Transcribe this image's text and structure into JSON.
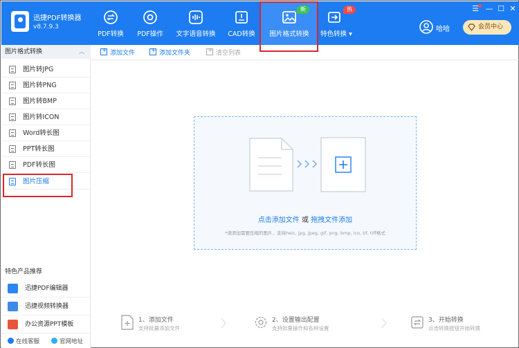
{
  "app": {
    "name": "迅捷PDF转换器",
    "version": "v8.7.9.3"
  },
  "nav": [
    {
      "label": "PDF转换",
      "icon": "swap-circle-icon"
    },
    {
      "label": "PDF操作",
      "icon": "gear-circle-icon"
    },
    {
      "label": "文字语音转换",
      "icon": "soundwave-icon"
    },
    {
      "label": "CAD转换",
      "icon": "cad-icon"
    },
    {
      "label": "图片格式转换",
      "icon": "image-icon",
      "badge": "新"
    },
    {
      "label": "特色转换",
      "icon": "feature-icon",
      "badge": "热"
    }
  ],
  "user": {
    "name": "哈哈",
    "member_label": "会员中心"
  },
  "sidebar": {
    "header": "图片格式转换",
    "items": [
      {
        "label": "图片转JPG"
      },
      {
        "label": "图片转PNG"
      },
      {
        "label": "图片转BMP"
      },
      {
        "label": "图片转ICON"
      },
      {
        "label": "Word转长图"
      },
      {
        "label": "PPT转长图"
      },
      {
        "label": "PDF转长图"
      },
      {
        "label": "图片压缩"
      }
    ],
    "recommend_title": "特色产品推荐",
    "recommend": [
      {
        "label": "迅捷PDF编辑器"
      },
      {
        "label": "迅捷视频转换器"
      },
      {
        "label": "办公资源PPT模板"
      }
    ],
    "links": [
      {
        "label": "在线客服"
      },
      {
        "label": "官网地址"
      }
    ]
  },
  "toolbar": {
    "add_file": "添加文件",
    "add_folder": "添加文件夹",
    "clear_list": "清空列表"
  },
  "dropzone": {
    "click_add": "点击添加文件",
    "or": "或",
    "drag_add": "拖拽文件添加",
    "hint": "*请添加需要压缩的图片，支持heic, jpg, jpeg, gif, png, bmp, ico, tif, tiff格式"
  },
  "steps": [
    {
      "title": "1、添加文件",
      "desc": "支持批量添加文件"
    },
    {
      "title": "2、设置输出配置",
      "desc": "支持批量操作和各种设置"
    },
    {
      "title": "3、开始转换",
      "desc": "点击转换按钮开始转换"
    }
  ],
  "colors": {
    "brand": "#1d7cf2",
    "highlight": "#d9262c",
    "new_badge": "#3fc35a",
    "hot_badge": "#f04a4a"
  }
}
